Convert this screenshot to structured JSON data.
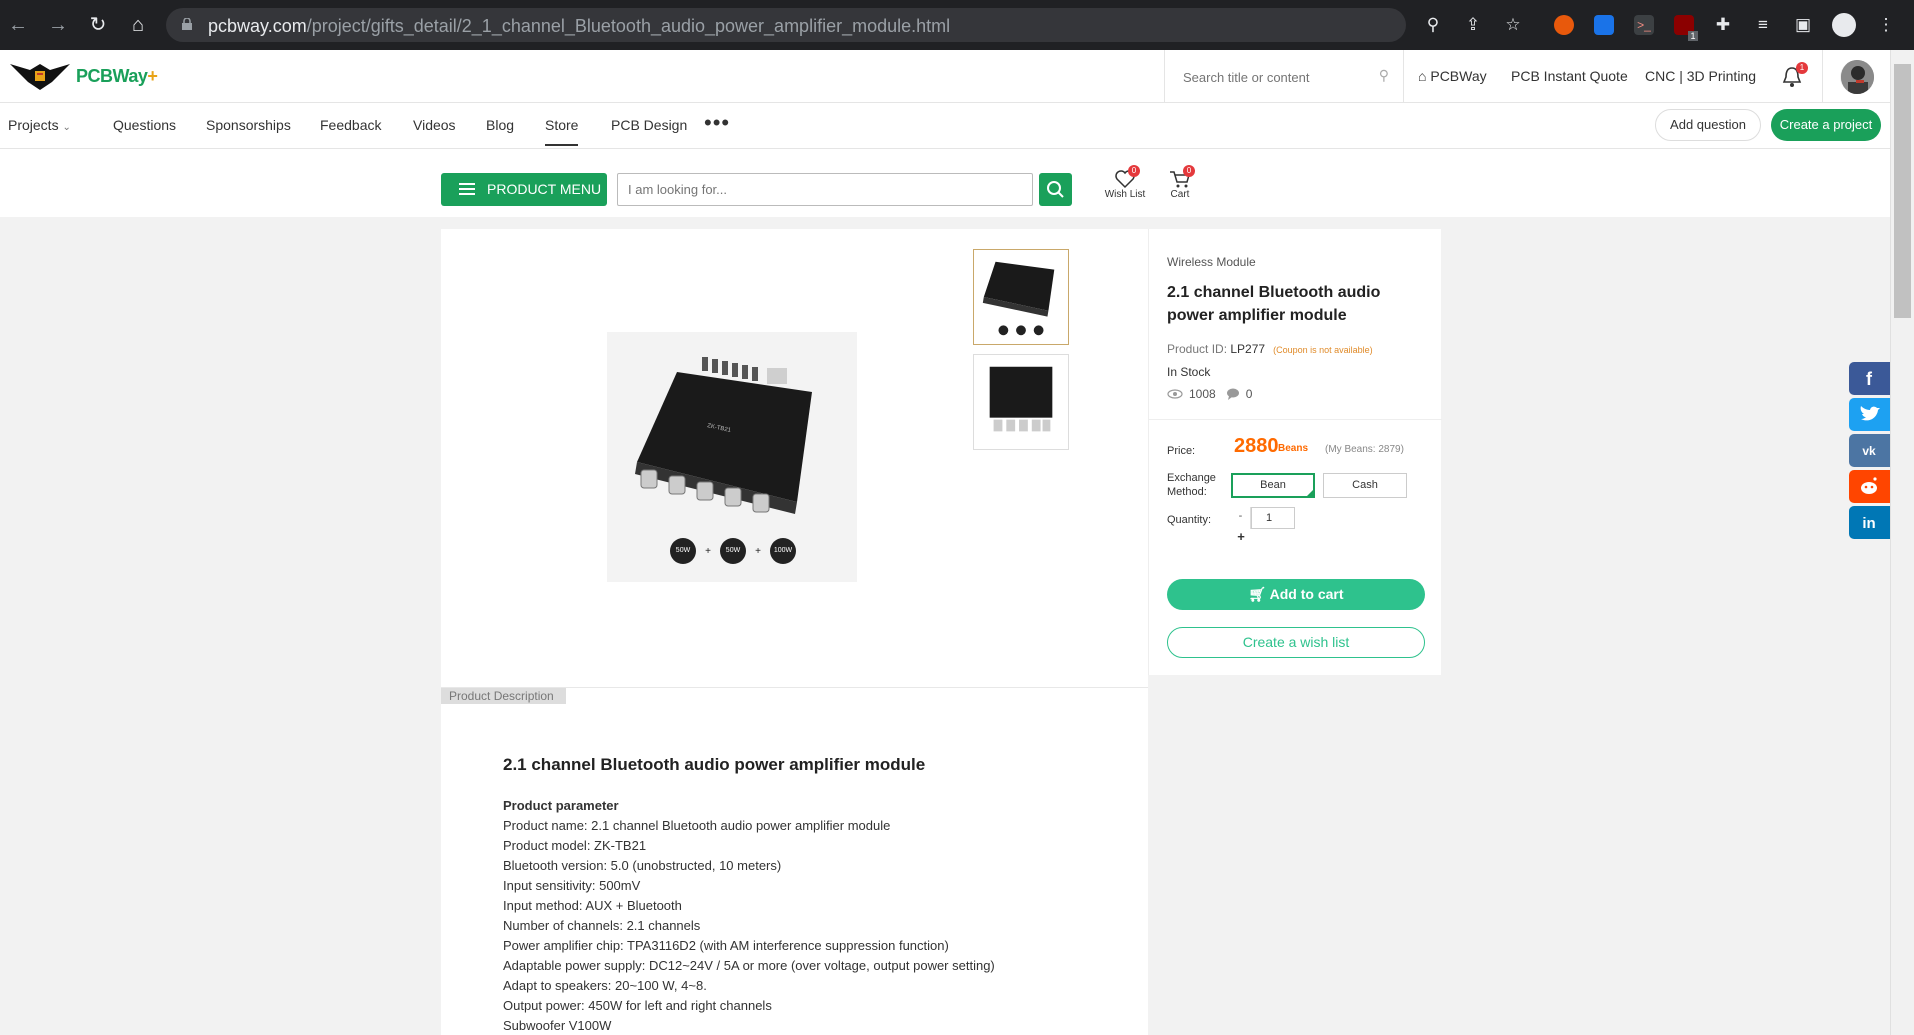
{
  "browser": {
    "url_host": "pcbway.com",
    "url_path": "/project/gifts_detail/2_1_channel_Bluetooth_audio_power_amplifier_module.html",
    "extension_badge": "1"
  },
  "header": {
    "logo_text": "PCBWay",
    "logo_plus": "+",
    "search_placeholder": "Search title or content",
    "links": [
      "PCBWay",
      "PCB Instant Quote",
      "CNC | 3D Printing"
    ],
    "notification_count": "1"
  },
  "nav": {
    "items": [
      "Projects",
      "Questions",
      "Sponsorships",
      "Feedback",
      "Videos",
      "Blog",
      "Store",
      "PCB Design"
    ],
    "active": "Store",
    "more": "•••",
    "add_question": "Add question",
    "create_project": "Create a project"
  },
  "store_bar": {
    "product_menu": "PRODUCT MENU",
    "search_placeholder": "I am looking for...",
    "wish_list_label": "Wish List",
    "wish_list_count": "0",
    "cart_label": "Cart",
    "cart_count": "0"
  },
  "product": {
    "category": "Wireless Module",
    "title": "2.1 channel Bluetooth audio power amplifier module",
    "product_id_label": "Product ID:",
    "product_id": "LP277",
    "coupon_note": "(Coupon is not available)",
    "stock": "In Stock",
    "views": "1008",
    "comments": "0",
    "price_label": "Price:",
    "price": "2880",
    "price_unit": "Beans",
    "my_beans": "(My Beans: 2879)",
    "exchange_label": "Exchange Method:",
    "exchange_options": [
      "Bean",
      "Cash"
    ],
    "exchange_selected": "Bean",
    "quantity_label": "Quantity:",
    "quantity": "1",
    "qty_minus": "-",
    "qty_plus": "+",
    "add_to_cart": "Add to cart",
    "create_wish": "Create a wish list",
    "image_badges": [
      "50W",
      "50W",
      "100W"
    ]
  },
  "description": {
    "tab": "Product Description",
    "title": "2.1 channel Bluetooth audio power amplifier module",
    "param_heading": "Product parameter",
    "lines": [
      "Product name: 2.1 channel Bluetooth audio power amplifier module",
      "Product model: ZK-TB21",
      "Bluetooth version: 5.0 (unobstructed, 10 meters)",
      "Input sensitivity: 500mV",
      "Input method: AUX + Bluetooth",
      "Number of channels: 2.1 channels",
      "Power amplifier chip: TPA3116D2 (with AM interference suppression function)",
      "Adaptable power supply: DC12~24V / 5A or more (over voltage, output power setting)",
      "Adapt to speakers: 20~100 W, 4~8.",
      "Output power: 450W for left and right channels",
      "Subwoofer V100W"
    ]
  },
  "share": {
    "networks": [
      "facebook",
      "twitter",
      "vk",
      "reddit",
      "linkedin"
    ],
    "colors": [
      "#3b5998",
      "#1da1f2",
      "#4c75a3",
      "#ff4500",
      "#0077b5"
    ]
  },
  "colors": {
    "brand_green": "#1aa05a",
    "price_orange": "#ff6a00",
    "cart_green": "#2ec28d"
  }
}
